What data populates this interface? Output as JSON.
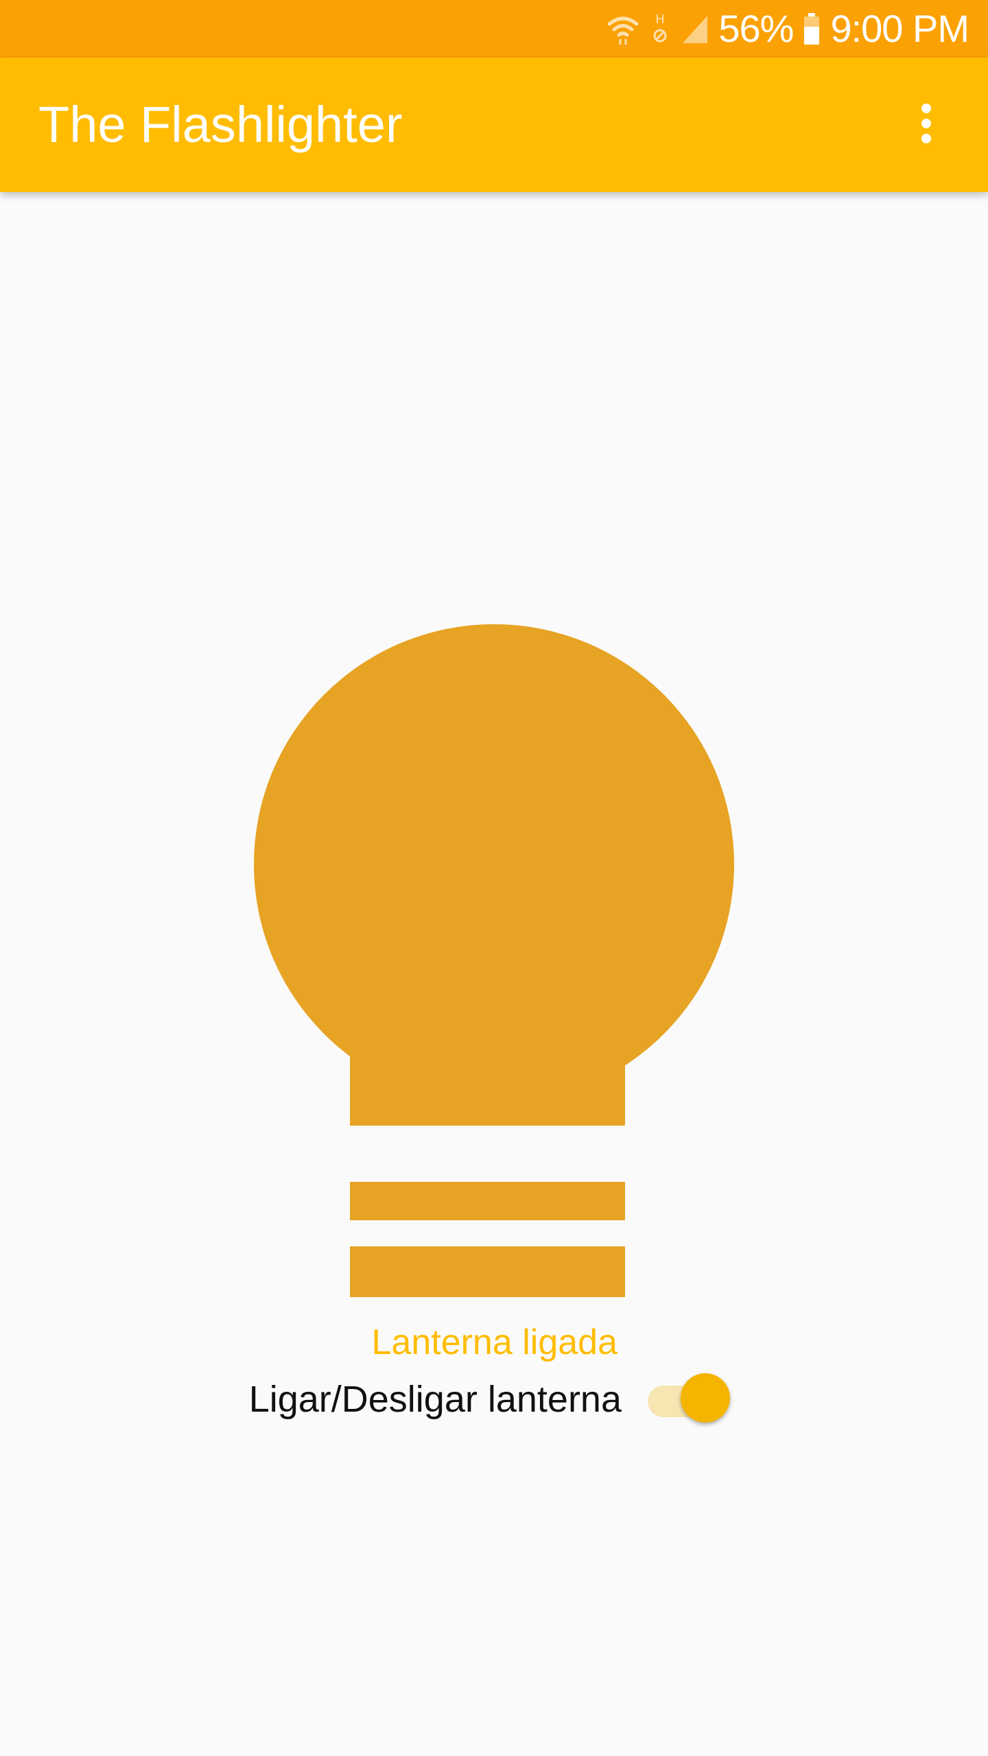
{
  "status_bar": {
    "battery_percent": "56%",
    "time": "9:00 PM",
    "icons": [
      "wifi-icon",
      "hd-voice-icon",
      "cellular-signal-icon",
      "battery-icon"
    ]
  },
  "app_bar": {
    "title": "The Flashlighter",
    "menu_icon": "more-vert-icon"
  },
  "main": {
    "bulb_icon": "lightbulb-icon",
    "flashlight_status": "Lanterna ligada",
    "switch": {
      "label": "Ligar/Desligar lanterna",
      "checked": true
    }
  },
  "colors": {
    "status_bar": "#fba104",
    "app_bar": "#ffbc00",
    "bulb": "#e7a323",
    "accent": "#f5b400",
    "background": "#fafafa"
  }
}
